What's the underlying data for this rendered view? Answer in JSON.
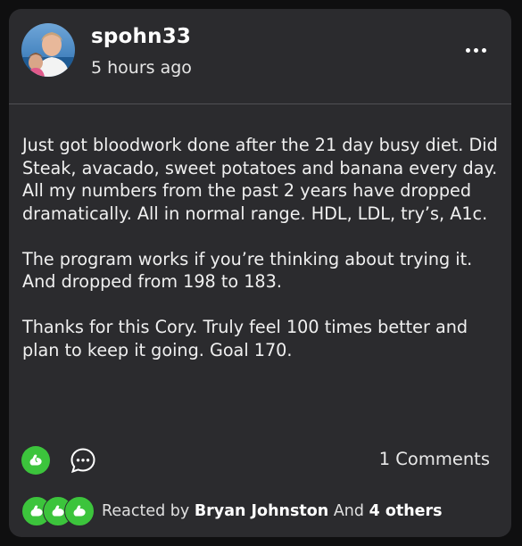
{
  "post": {
    "username": "spohn33",
    "timestamp": "5 hours ago",
    "body": "Just got bloodwork done after the 21 day busy diet. Did Steak, avacado, sweet potatoes and banana every day. All my numbers from the past 2 years have dropped dramatically. All in normal range. HDL, LDL, try’s, A1c.\n\nThe program works if you’re thinking about trying it. And dropped from 198 to 183.\n\nThanks for this Cory. Truly feel 100 times better and plan to keep it going. Goal 170.",
    "comments_label": "1 Comments",
    "reactions": {
      "prefix": "Reacted by ",
      "user": "Bryan Johnston",
      "conjunction": " And ",
      "others": "4 others"
    }
  },
  "icons": {
    "avatar": "user-avatar-photo",
    "more": "more-horizontal-icon",
    "like": "flexed-bicep-icon",
    "comment": "comment-bubble-icon"
  },
  "colors": {
    "background": "#0f0f10",
    "card": "#2b2b2e",
    "accent_green": "#3cc43c",
    "text": "#f0f0f0"
  }
}
